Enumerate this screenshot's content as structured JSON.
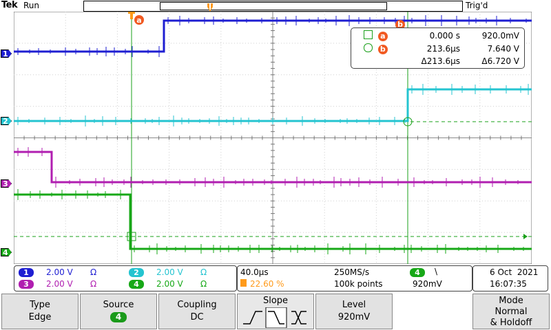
{
  "header": {
    "logo": "Tek",
    "run_state": "Run",
    "trigger_state": "Trig'd"
  },
  "channels": [
    {
      "id": "1",
      "color": "#1e1ed2",
      "scale": "2.00 V",
      "coupling_icon": "ohm-icon"
    },
    {
      "id": "2",
      "color": "#24c4d0",
      "scale": "2.00 V",
      "coupling_icon": "ohm-icon"
    },
    {
      "id": "3",
      "color": "#b01eb0",
      "scale": "2.00 V",
      "coupling_icon": "ohm-icon"
    },
    {
      "id": "4",
      "color": "#17a817",
      "scale": "2.00 V",
      "coupling_icon": "ohm-icon"
    }
  ],
  "cursors": {
    "a_label": "a",
    "b_label": "b",
    "a_time": "0.000 s",
    "a_value": "920.0mV",
    "b_time": "213.6µs",
    "b_value": "7.640 V",
    "delta_time": "Δ213.6µs",
    "delta_value": "Δ6.720 V"
  },
  "timebase": {
    "scale": "40.0µs",
    "trigger_pos": "22.60 %",
    "sample_rate": "250MS/s",
    "record_length": "100k points"
  },
  "trigger": {
    "source": "4",
    "slope_symbol": "\\",
    "level": "920mV"
  },
  "datetime": {
    "date": "6 Oct  2021",
    "time": "16:07:35"
  },
  "menu": {
    "type_title": "Type",
    "type_value": "Edge",
    "source_title": "Source",
    "source_value": "4",
    "coupling_title": "Coupling",
    "coupling_value": "DC",
    "slope_title": "Slope",
    "level_title": "Level",
    "level_value": "920mV",
    "mode_title": "Mode",
    "mode_value_1": "Normal",
    "mode_value_2": "& Holdoff"
  }
}
